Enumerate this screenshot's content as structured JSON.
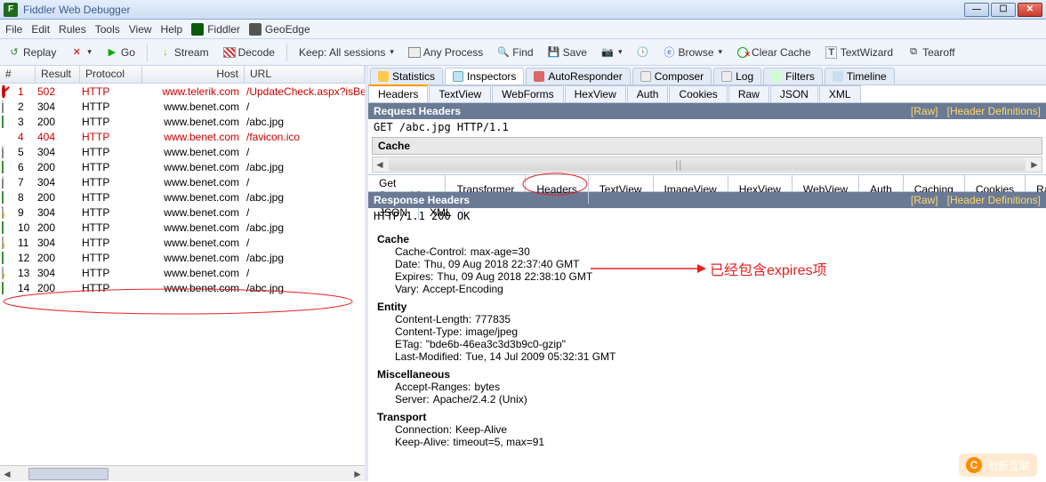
{
  "title": "Fiddler Web Debugger",
  "menu": [
    "File",
    "Edit",
    "Rules",
    "Tools",
    "View",
    "Help"
  ],
  "menu_ext": [
    {
      "icon": "icon-fiddler",
      "label": "Fiddler"
    },
    {
      "icon": "icon-geo",
      "label": "GeoEdge"
    }
  ],
  "toolbar": {
    "replay": "Replay",
    "go": "Go",
    "stream": "Stream",
    "decode": "Decode",
    "keep": "Keep: All sessions",
    "anyproc": "Any Process",
    "find": "Find",
    "save": "Save",
    "browse": "Browse",
    "clear": "Clear Cache",
    "tw": "TextWizard",
    "tear": "Tearoff"
  },
  "cols": {
    "num": "#",
    "result": "Result",
    "protocol": "Protocol",
    "host": "Host",
    "url": "URL"
  },
  "rows": [
    {
      "n": "1",
      "res": "502",
      "prot": "HTTP",
      "host": "www.telerik.com",
      "url": "/UpdateCheck.aspx?isBet",
      "red": true,
      "icon": "err"
    },
    {
      "n": "2",
      "res": "304",
      "prot": "HTTP",
      "host": "www.benet.com",
      "url": "/",
      "icon": "doc"
    },
    {
      "n": "3",
      "res": "200",
      "prot": "HTTP",
      "host": "www.benet.com",
      "url": "/abc.jpg",
      "icon": "img"
    },
    {
      "n": "4",
      "res": "404",
      "prot": "HTTP",
      "host": "www.benet.com",
      "url": "/favicon.ico",
      "red": true,
      "icon": "warn"
    },
    {
      "n": "5",
      "res": "304",
      "prot": "HTTP",
      "host": "www.benet.com",
      "url": "/",
      "icon": "doc"
    },
    {
      "n": "6",
      "res": "200",
      "prot": "HTTP",
      "host": "www.benet.com",
      "url": "/abc.jpg",
      "icon": "img"
    },
    {
      "n": "7",
      "res": "304",
      "prot": "HTTP",
      "host": "www.benet.com",
      "url": "/",
      "icon": "doc"
    },
    {
      "n": "8",
      "res": "200",
      "prot": "HTTP",
      "host": "www.benet.com",
      "url": "/abc.jpg",
      "icon": "img"
    },
    {
      "n": "9",
      "res": "304",
      "prot": "HTTP",
      "host": "www.benet.com",
      "url": "/",
      "icon": "cache"
    },
    {
      "n": "10",
      "res": "200",
      "prot": "HTTP",
      "host": "www.benet.com",
      "url": "/abc.jpg",
      "icon": "img"
    },
    {
      "n": "11",
      "res": "304",
      "prot": "HTTP",
      "host": "www.benet.com",
      "url": "/",
      "icon": "cache"
    },
    {
      "n": "12",
      "res": "200",
      "prot": "HTTP",
      "host": "www.benet.com",
      "url": "/abc.jpg",
      "icon": "img"
    },
    {
      "n": "13",
      "res": "304",
      "prot": "HTTP",
      "host": "www.benet.com",
      "url": "/",
      "icon": "cache"
    },
    {
      "n": "14",
      "res": "200",
      "prot": "HTTP",
      "host": "www.benet.com",
      "url": "/abc.jpg",
      "icon": "img"
    }
  ],
  "top_tabs": [
    "Statistics",
    "Inspectors",
    "AutoResponder",
    "Composer",
    "Log",
    "Filters",
    "Timeline"
  ],
  "active_top": 1,
  "req_tabs": [
    "Headers",
    "TextView",
    "WebForms",
    "HexView",
    "Auth",
    "Cookies",
    "Raw",
    "JSON",
    "XML"
  ],
  "active_req": 0,
  "req_head_title": "Request Headers",
  "raw_link": "[Raw]",
  "defs_link": "[Header Definitions]",
  "req_line": "GET /abc.jpg HTTP/1.1",
  "cache_label": "Cache",
  "resp_tabs": [
    "Get SyntaxView",
    "Transformer",
    "Headers",
    "TextView",
    "ImageView",
    "HexView",
    "WebView",
    "Auth",
    "Caching",
    "Cookies",
    "Raw"
  ],
  "resp_tabs2": [
    "JSON",
    "XML"
  ],
  "active_resp": 2,
  "resp_head_title": "Response Headers",
  "resp_status": "HTTP/1.1 200 OK",
  "resp_groups": [
    {
      "name": "Cache",
      "items": [
        {
          "k": "Cache-Control:",
          "v": "max-age=30"
        },
        {
          "k": "Date:",
          "v": "Thu, 09 Aug 2018 22:37:40 GMT"
        },
        {
          "k": "Expires:",
          "v": "Thu, 09 Aug 2018 22:38:10 GMT"
        },
        {
          "k": "Vary:",
          "v": "Accept-Encoding"
        }
      ]
    },
    {
      "name": "Entity",
      "items": [
        {
          "k": "Content-Length:",
          "v": "777835"
        },
        {
          "k": "Content-Type:",
          "v": "image/jpeg"
        },
        {
          "k": "ETag:",
          "v": "\"bde6b-46ea3c3d3b9c0-gzip\""
        },
        {
          "k": "Last-Modified:",
          "v": "Tue, 14 Jul 2009 05:32:31 GMT"
        }
      ]
    },
    {
      "name": "Miscellaneous",
      "items": [
        {
          "k": "Accept-Ranges:",
          "v": "bytes"
        },
        {
          "k": "Server:",
          "v": "Apache/2.4.2 (Unix)"
        }
      ]
    },
    {
      "name": "Transport",
      "items": [
        {
          "k": "Connection:",
          "v": "Keep-Alive"
        },
        {
          "k": "Keep-Alive:",
          "v": "timeout=5, max=91"
        }
      ]
    }
  ],
  "annotation": "已经包含expires项",
  "watermark": "创新互联"
}
